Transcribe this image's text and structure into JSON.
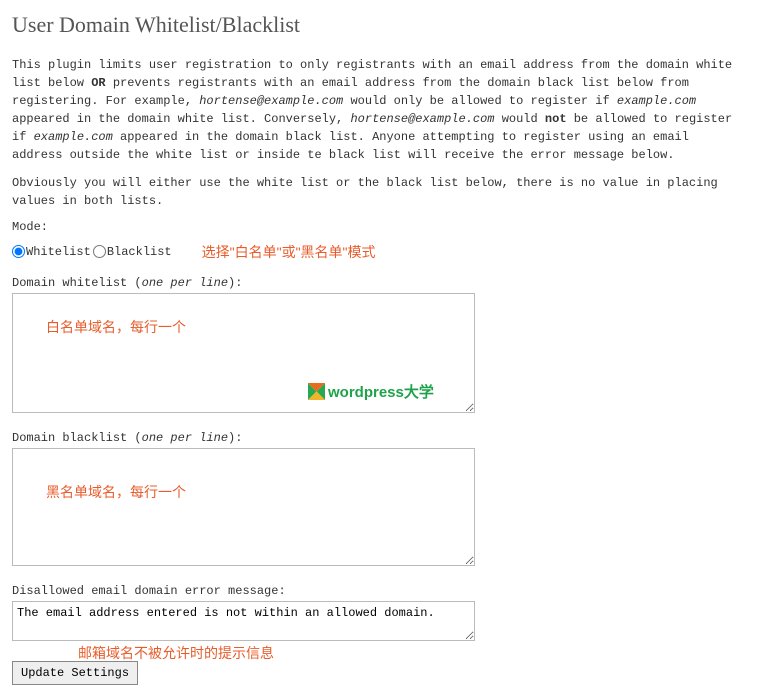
{
  "title": "User Domain Whitelist/Blacklist",
  "description": {
    "p1_a": "This plugin limits user registration to only registrants with an email address from the domain white list below ",
    "p1_or": "OR",
    "p1_b": " prevents registrants with an email address from the domain black list below from registering. For example, ",
    "p1_ex1": "hortense@example.com",
    "p1_c": " would only be allowed to register if ",
    "p1_ex2": "example.com",
    "p1_d": " appeared in the domain white list. Conversely, ",
    "p1_ex3": "hortense@example.com",
    "p1_e": " would ",
    "p1_not": "not",
    "p1_f": " be allowed to register if ",
    "p1_ex4": "example.com",
    "p1_g": " appeared in the domain black list. Anyone attempting to register using an email address outside the white list or inside te black list will receive the error message below.",
    "p2": "Obviously you will either use the white list or the black list below, there is no value in placing values in both lists."
  },
  "mode": {
    "label": "Mode:",
    "whitelist": "Whitelist",
    "blacklist": "Blacklist",
    "selected": "whitelist",
    "annotation": "选择\"白名单\"或\"黑名单\"模式"
  },
  "whitelist_field": {
    "label_a": "Domain whitelist (",
    "label_i": "one per line",
    "label_b": "):",
    "value": "",
    "annotation": "白名单域名，每行一个"
  },
  "blacklist_field": {
    "label_a": "Domain blacklist (",
    "label_i": "one per line",
    "label_b": "):",
    "value": "",
    "annotation": "黑名单域名，每行一个"
  },
  "error_field": {
    "label": "Disallowed email domain error message:",
    "value": "The email address entered is not within an allowed domain.",
    "annotation": "邮箱域名不被允许时的提示信息"
  },
  "watermark": {
    "en": "wordpress",
    "cn": "大学"
  },
  "submit": "Update Settings"
}
